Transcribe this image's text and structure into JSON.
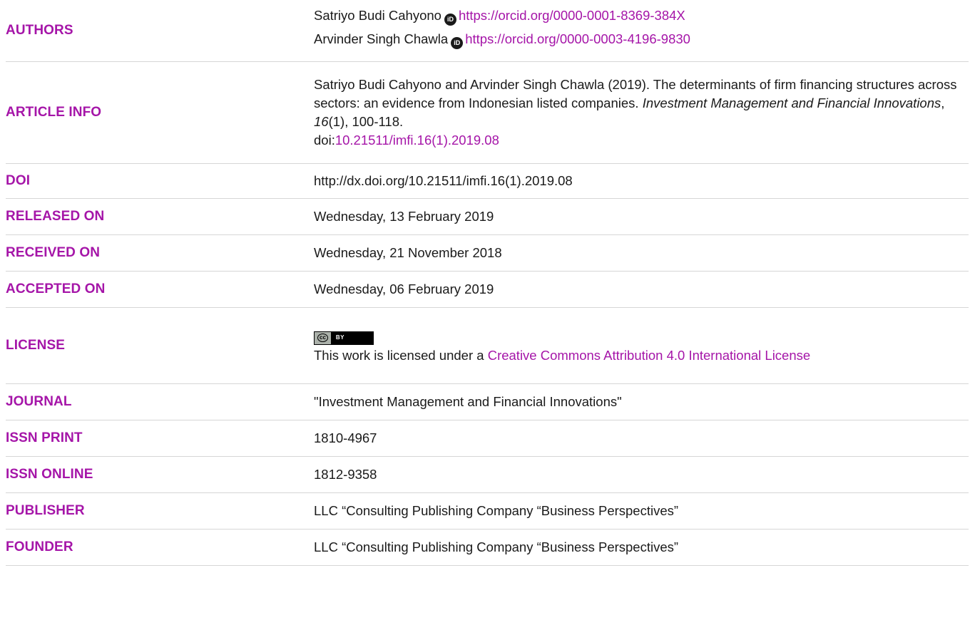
{
  "rows": {
    "authors": {
      "label": "AUTHORS",
      "author1_name": "Satriyo Budi Cahyono",
      "author1_orcid": "https://orcid.org/0000-0001-8369-384X",
      "author2_name": "Arvinder Singh Chawla",
      "author2_orcid": "https://orcid.org/0000-0003-4196-9830",
      "orcid_icon_text": "iD"
    },
    "article_info": {
      "label": "ARTICLE INFO",
      "citation_part1": "Satriyo Budi Cahyono and Arvinder Singh Chawla (2019). The determinants of firm financing structures across sectors: an evidence from Indonesian listed companies. ",
      "journal_italic": "Investment Management and Financial Innovations",
      "comma_sep": ", ",
      "volume_italic": "16",
      "citation_part2": "(1), 100-118.",
      "doi_prefix": "doi:",
      "doi_link": "10.21511/imfi.16(1).2019.08"
    },
    "doi": {
      "label": "DOI",
      "value": "http://dx.doi.org/10.21511/imfi.16(1).2019.08"
    },
    "released_on": {
      "label": "RELEASED ON",
      "value": "Wednesday, 13 February 2019"
    },
    "received_on": {
      "label": "RECEIVED ON",
      "value": "Wednesday, 21 November 2018"
    },
    "accepted_on": {
      "label": "ACCEPTED ON",
      "value": "Wednesday, 06 February 2019"
    },
    "license": {
      "label": "LICENSE",
      "badge_cc": "cc",
      "badge_by": "BY",
      "text_prefix": "This work is licensed under a ",
      "link_text": "Creative Commons Attribution 4.0 International License"
    },
    "journal": {
      "label": "JOURNAL",
      "value": "\"Investment Management and Financial Innovations\""
    },
    "issn_print": {
      "label": "ISSN PRINT",
      "value": "1810-4967"
    },
    "issn_online": {
      "label": "ISSN ONLINE",
      "value": "1812-9358"
    },
    "publisher": {
      "label": "PUBLISHER",
      "value": "LLC “Consulting Publishing Company “Business Perspectives”"
    },
    "founder": {
      "label": "FOUNDER",
      "value": "LLC “Consulting Publishing Company “Business Perspectives”"
    }
  },
  "colors": {
    "label_accent": "#a515a8",
    "text": "#1a1a1a",
    "divider": "#d6d6d6"
  }
}
